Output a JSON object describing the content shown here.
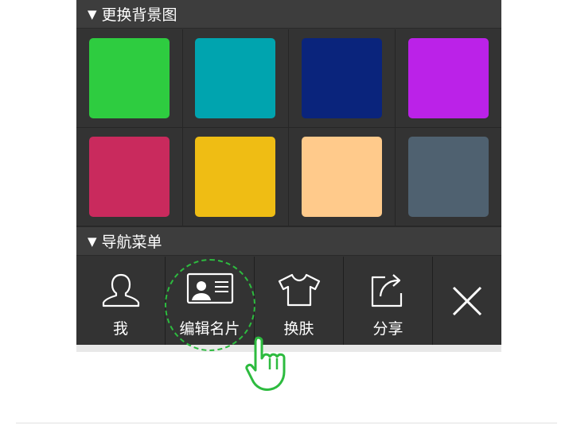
{
  "sections": {
    "background": {
      "title": "更换背景图",
      "arrow": "▼"
    },
    "nav": {
      "title": "导航菜单",
      "arrow": "▼"
    }
  },
  "swatches": [
    {
      "name": "green",
      "color": "#2ecc40"
    },
    {
      "name": "teal",
      "color": "#00a4af"
    },
    {
      "name": "navy",
      "color": "#0a247c"
    },
    {
      "name": "purple",
      "color": "#bb22e8"
    },
    {
      "name": "crimson",
      "color": "#c92a5d"
    },
    {
      "name": "yellow",
      "color": "#efbd14"
    },
    {
      "name": "peach",
      "color": "#ffca8b"
    },
    {
      "name": "slate",
      "color": "#4f6170"
    }
  ],
  "nav_items": [
    {
      "label": "我",
      "icon": "user-icon"
    },
    {
      "label": "编辑名片",
      "icon": "id-card-icon"
    },
    {
      "label": "换肤",
      "icon": "tshirt-icon"
    },
    {
      "label": "分享",
      "icon": "share-icon"
    }
  ],
  "close": {
    "icon": "close-icon"
  },
  "colors": {
    "panel": "#333333",
    "header": "#3d3d3d",
    "highlight": "#2dbb3f"
  }
}
